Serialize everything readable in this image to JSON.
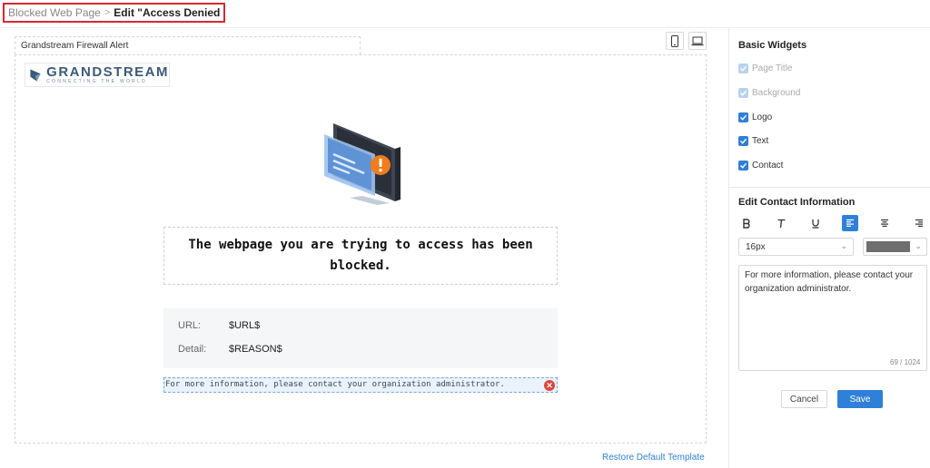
{
  "breadcrumb": {
    "parent": "Blocked Web Page",
    "separator": ">",
    "current": "Edit \"Access Denied"
  },
  "editor": {
    "page_title_tab": "Grandstream Firewall Alert",
    "device_buttons": [
      "mobile-icon",
      "laptop-icon"
    ],
    "logo": {
      "name": "GRANDSTREAM",
      "tagline": "CONNECTING THE WORLD"
    },
    "illustration": "blocked-computer-icon",
    "headline": "The webpage you are trying to access has been blocked.",
    "info": {
      "url_label": "URL:",
      "url_value": "$URL$",
      "detail_label": "Detail:",
      "detail_value": "$REASON$"
    },
    "contact_text": "For more information, please contact your organization administrator.",
    "restore_link": "Restore Default Template"
  },
  "sidebar": {
    "basic_widgets_title": "Basic Widgets",
    "widgets": [
      {
        "label": "Page Title",
        "checked": true,
        "enabled": false
      },
      {
        "label": "Background",
        "checked": true,
        "enabled": false
      },
      {
        "label": "Logo",
        "checked": true,
        "enabled": true
      },
      {
        "label": "Text",
        "checked": true,
        "enabled": true
      },
      {
        "label": "Contact",
        "checked": true,
        "enabled": true
      }
    ],
    "edit_contact_title": "Edit Contact Information",
    "format_buttons": [
      "bold-icon",
      "italic-icon",
      "underline-icon",
      "align-left-icon",
      "align-center-icon",
      "align-right-icon"
    ],
    "active_format": "align-left-icon",
    "font_size": "16px",
    "text_color": "#6e6e6e",
    "contact_text": "For more information, please contact your organization administrator.",
    "char_count": "69 / 1024",
    "cancel_label": "Cancel",
    "save_label": "Save"
  },
  "colors": {
    "accent": "#2f80d8",
    "highlight_border": "#d9282f",
    "alert_orange": "#f07c1c"
  }
}
